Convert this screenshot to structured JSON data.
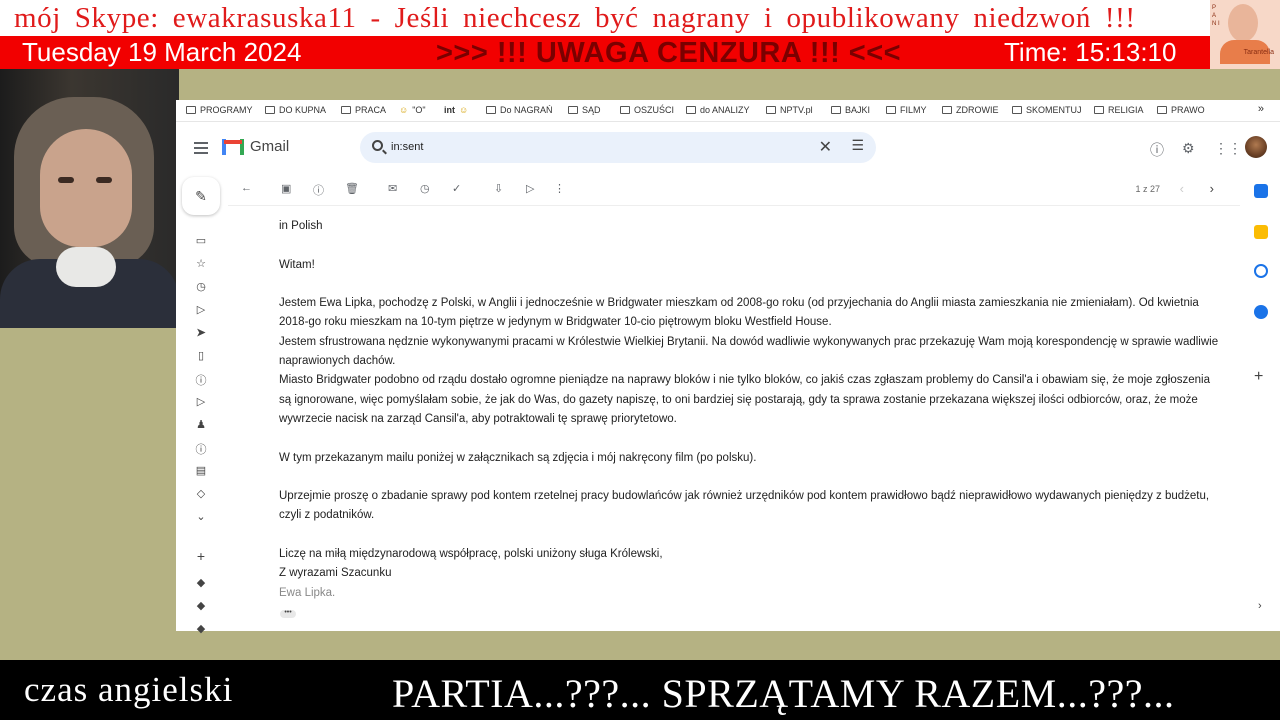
{
  "banner": {
    "skype_text": "mój Skype: ewakrasuska11  - Jeśli niechcesz być nagrany i opublikowany niedzwoń !!!",
    "date": "Tuesday 19 March 2024",
    "warning": ">>> !!! UWAGA CENZURA !!! <<<",
    "time": "Time: 15:13:10"
  },
  "profile": {
    "caption": "Tarantella",
    "side_text": "P A N I"
  },
  "bookmarks": [
    {
      "label": "PROGRAMY",
      "icon": "folder-icon"
    },
    {
      "label": "DO KUPNA",
      "icon": "folder-icon"
    },
    {
      "label": "PRACA",
      "icon": "folder-icon"
    },
    {
      "label": "\"O\"",
      "icon": "emoji-icon"
    },
    {
      "label": "int",
      "icon": "site-icon"
    },
    {
      "label": "Do NAGRAŃ",
      "icon": "folder-icon"
    },
    {
      "label": "SĄD",
      "icon": "folder-icon"
    },
    {
      "label": "OSZUŚCI",
      "icon": "folder-icon"
    },
    {
      "label": "do ANALIZY",
      "icon": "folder-icon"
    },
    {
      "label": "NPTV.pl",
      "icon": "folder-icon"
    },
    {
      "label": "BAJKI",
      "icon": "folder-icon"
    },
    {
      "label": "FILMY",
      "icon": "folder-icon"
    },
    {
      "label": "ZDROWIE",
      "icon": "folder-icon"
    },
    {
      "label": "SKOMENTUJ",
      "icon": "folder-icon"
    },
    {
      "label": "RELIGIA",
      "icon": "folder-icon"
    },
    {
      "label": "PRAWO",
      "icon": "folder-icon"
    }
  ],
  "bookmarks_more": "»",
  "gmail": {
    "logo_text": "Gmail",
    "search_value": "in:sent",
    "pager": "1 z 27"
  },
  "email": {
    "lang_note": "in Polish",
    "greeting": "Witam!",
    "para1": "Jestem Ewa Lipka, pochodzę z Polski, w Anglii i jednocześnie w Bridgwater mieszkam od 2008-go roku (od przyjechania do Anglii miasta zamieszkania nie zmieniałam). Od kwietnia 2018-go roku mieszkam na 10-tym piętrze w jedynym w Bridgwater 10-cio piętrowym bloku Westfield House.",
    "para2": "Jestem sfrustrowana nędznie wykonywanymi pracami w Królestwie Wielkiej Brytanii. Na dowód wadliwie wykonywanych prac przekazuję Wam moją korespondencję w sprawie wadliwie naprawionych dachów.",
    "para3": "Miasto Bridgwater podobno od rządu dostało ogromne pieniądze na naprawy bloków i nie tylko bloków, co jakiś czas zgłaszam problemy do Cansil'a i obawiam się, że moje zgłoszenia są ignorowane, więc pomyślałam sobie, że jak do Was, do gazety napiszę, to oni bardziej się postarają, gdy ta sprawa zostanie przekazana większej ilości odbiorców, oraz, że może wywrzecie nacisk na zarząd Cansil'a, aby potraktowali tę sprawę priorytetowo.",
    "para4": "W tym przekazanym mailu poniżej w załącznikach są zdjęcia i mój nakręcony film (po polsku).",
    "para5": "Uprzejmie proszę o zbadanie sprawy pod kontem rzetelnej pracy budowlańców jak również urzędników pod kontem prawidłowo bądź nieprawidłowo wydawanych pieniędzy z budżetu, czyli z podatników.",
    "closing1": "Liczę na miłą międzynarodową współpracę, polski uniżony sługa Królewski,",
    "closing2": "Z wyrazami Szacunku",
    "signature": "Ewa Lipka."
  },
  "bottom": {
    "left": "czas  angielski",
    "right": "PARTIA...???...  SPRZĄTAMY RAZEM...???..."
  },
  "colors": {
    "banner_red": "#f20000",
    "warning_text": "#7a0000",
    "skype_text": "#e01b1b",
    "background": "#b5b283"
  }
}
